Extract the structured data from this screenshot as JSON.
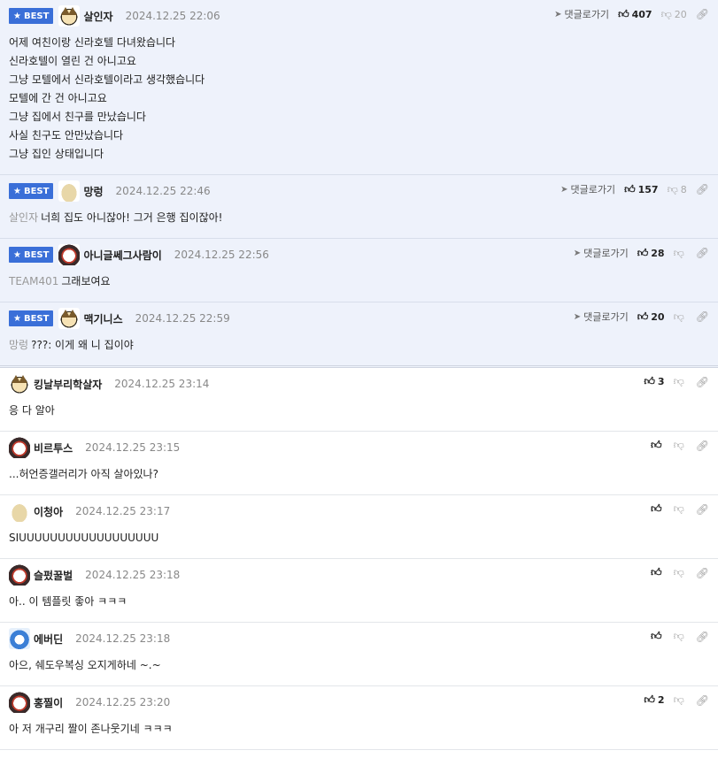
{
  "labels": {
    "best": "BEST",
    "goto_reply": "댓글로가기"
  },
  "comments": [
    {
      "best": true,
      "nick": "살인자",
      "avatar": "fox-avatar",
      "date": "2024.12.25 22:06",
      "reply_to": "",
      "lines": [
        "어제 여친이랑 신라호텔 다녀왔습니다",
        "신라호텔이 열린 건 아니고요",
        "그냥 모텔에서 신라호텔이라고 생각했습니다",
        "모텔에 간 건 아니고요",
        "그냥 집에서 친구를 만났습니다",
        "사실 친구도 안만났습니다",
        "그냥 집인 상태입니다"
      ],
      "up": "407",
      "down": "20"
    },
    {
      "best": true,
      "nick": "망렁",
      "avatar": "blob-avatar",
      "date": "2024.12.25 22:46",
      "reply_to": "살인자",
      "lines": [
        "너희 집도 아니잖아! 그거 은행 집이잖아!"
      ],
      "up": "157",
      "down": "8"
    },
    {
      "best": true,
      "nick": "아니글쎄그사람이",
      "avatar": "dog-avatar",
      "date": "2024.12.25 22:56",
      "reply_to": "TEAM401",
      "lines": [
        "그래보여요"
      ],
      "up": "28",
      "down": ""
    },
    {
      "best": true,
      "nick": "맥기니스",
      "avatar": "fox-avatar",
      "date": "2024.12.25 22:59",
      "reply_to": "망렁",
      "lines": [
        "???: 이게 왜 니 집이야"
      ],
      "up": "20",
      "down": ""
    },
    {
      "best": false,
      "nick": "킹날부리학살자",
      "avatar": "fox-avatar",
      "date": "2024.12.25 23:14",
      "reply_to": "",
      "lines": [
        "응 다 알아"
      ],
      "up": "3",
      "down": ""
    },
    {
      "best": false,
      "nick": "비르투스",
      "avatar": "dog-avatar",
      "date": "2024.12.25 23:15",
      "reply_to": "",
      "lines": [
        "...허언증갤러리가 아직 살아있나?"
      ],
      "up": "",
      "down": ""
    },
    {
      "best": false,
      "nick": "이청아",
      "avatar": "blob-avatar",
      "date": "2024.12.25 23:17",
      "reply_to": "",
      "lines": [
        "SIUUUUUUUUUUUUUUUUUU"
      ],
      "up": "",
      "down": ""
    },
    {
      "best": false,
      "nick": "슬펐꿀벌",
      "avatar": "dog-avatar",
      "date": "2024.12.25 23:18",
      "reply_to": "",
      "lines": [
        "아.. 이 템플릿 좋아 ㅋㅋㅋ"
      ],
      "up": "",
      "down": ""
    },
    {
      "best": false,
      "nick": "에버딘",
      "avatar": "blue-avatar",
      "date": "2024.12.25 23:18",
      "reply_to": "",
      "lines": [
        "아으, 쉐도우복싱 오지게하네 ~.~"
      ],
      "up": "",
      "down": ""
    },
    {
      "best": false,
      "nick": "홍찔이",
      "avatar": "dog-avatar",
      "date": "2024.12.25 23:20",
      "reply_to": "",
      "lines": [
        "아 저 개구리 짤이 존나웃기네 ㅋㅋㅋ"
      ],
      "up": "2",
      "down": ""
    }
  ]
}
